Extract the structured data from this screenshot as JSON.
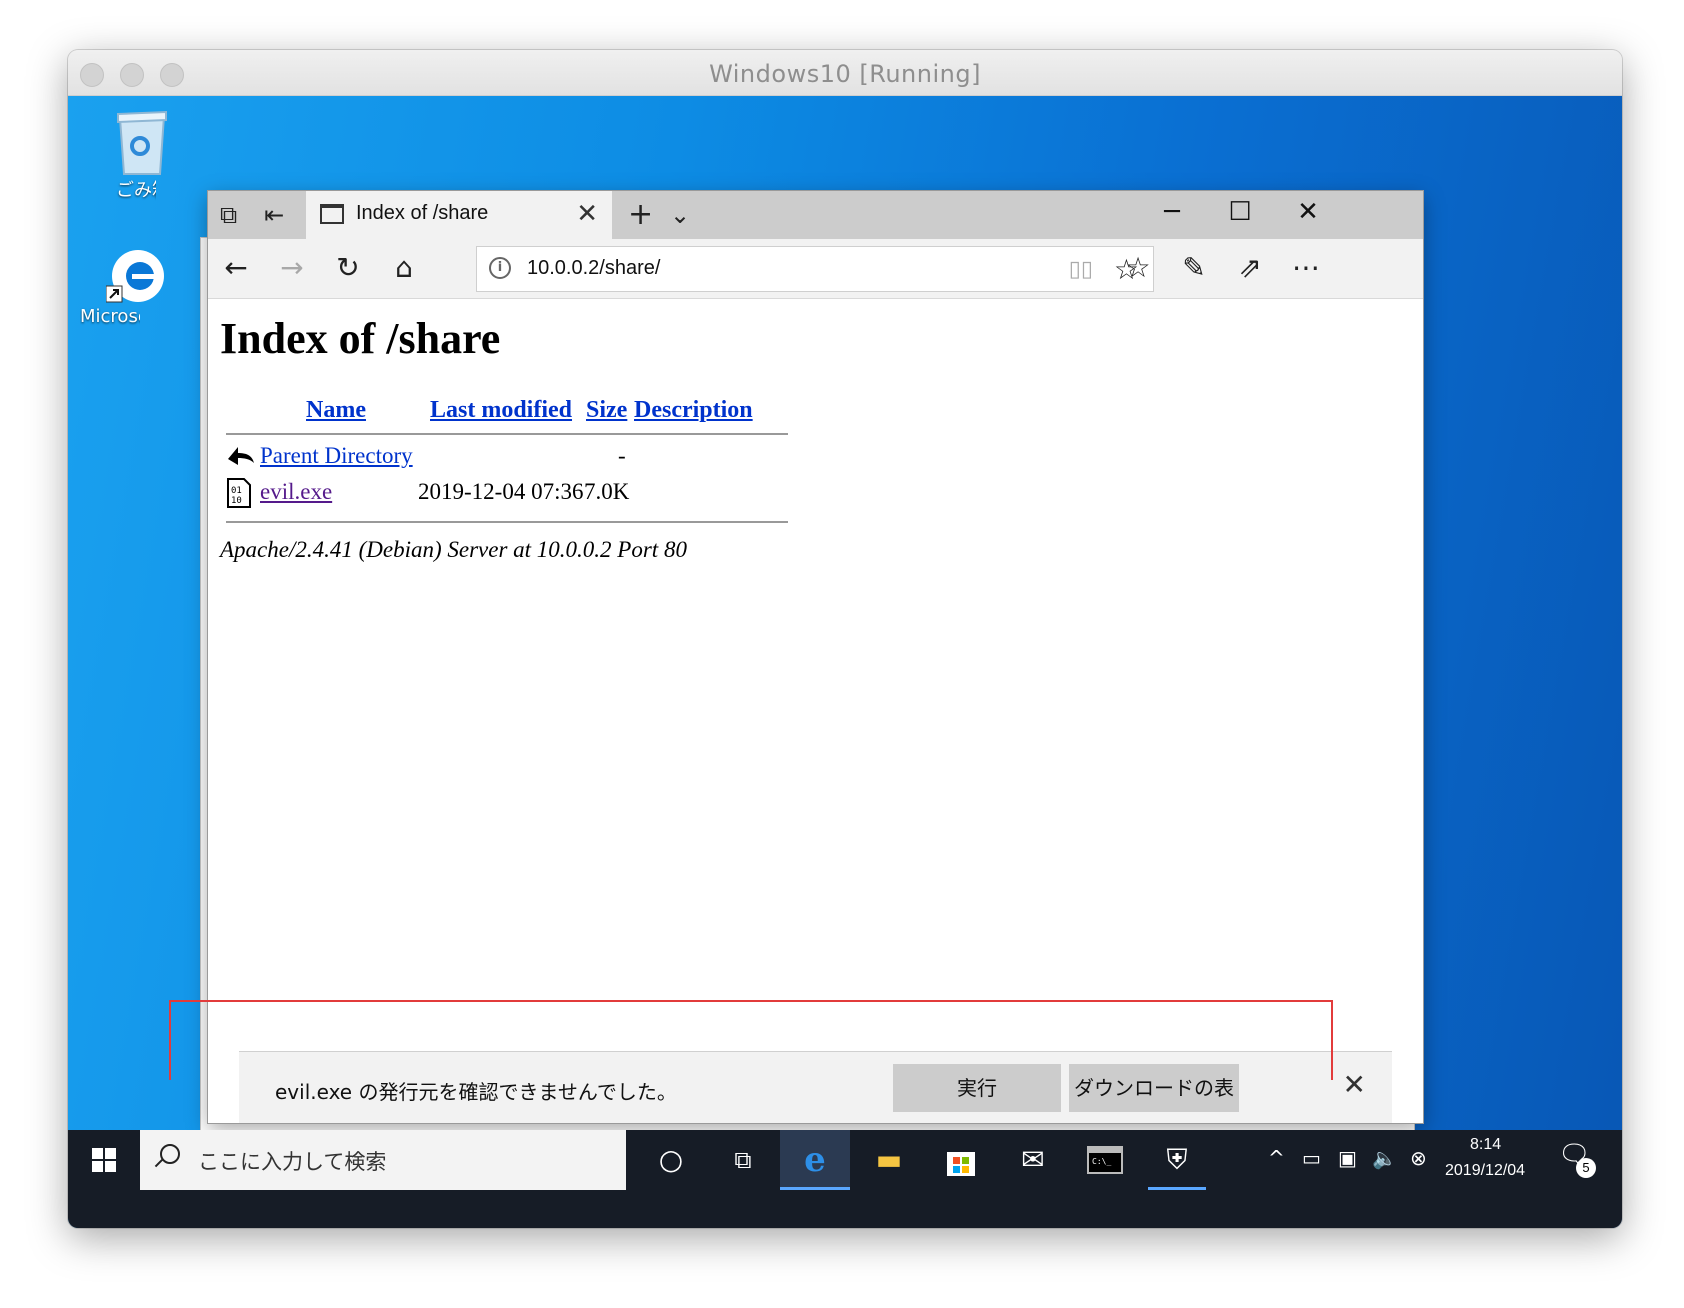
{
  "vm": {
    "title": "Windows10 [Running]"
  },
  "desktop": {
    "icons": [
      {
        "label": "ごみ箱",
        "icon": "recycle-bin-icon"
      },
      {
        "label": "Microsoft Edge",
        "icon": "edge-icon"
      }
    ]
  },
  "browser": {
    "tab_title": "Index of /share",
    "address": "10.0.0.2/share/",
    "controls": {
      "minimize": "─",
      "maximize": "☐",
      "close": "✕"
    }
  },
  "page": {
    "heading": "Index of /share",
    "columns": {
      "name": "Name",
      "last_modified": "Last modified",
      "size": "Size",
      "description": "Description"
    },
    "rows": [
      {
        "name": "Parent Directory",
        "last_modified": "",
        "size": "-",
        "description": "",
        "icon": "back-arrow-icon",
        "visited": false
      },
      {
        "name": "evil.exe",
        "last_modified": "2019-12-04 07:36",
        "size": "7.0K",
        "description": "",
        "icon": "binary-file-icon",
        "visited": true
      }
    ],
    "server_signature": "Apache/2.4.41 (Debian) Server at 10.0.0.2 Port 80"
  },
  "download_bar": {
    "message": "evil.exe の発行元を確認できませんでした。",
    "run_label": "実行",
    "view_downloads_label": "ダウンロードの表示"
  },
  "taskbar": {
    "search_placeholder": "ここに入力して検索",
    "time": "8:14",
    "date": "2019/12/04",
    "notification_count": "5"
  },
  "colors": {
    "link": "#0033cc",
    "visited_link": "#551a8b",
    "highlight": "#e23b3b",
    "taskbar": "#161c26",
    "accent": "#5aa7ff"
  }
}
